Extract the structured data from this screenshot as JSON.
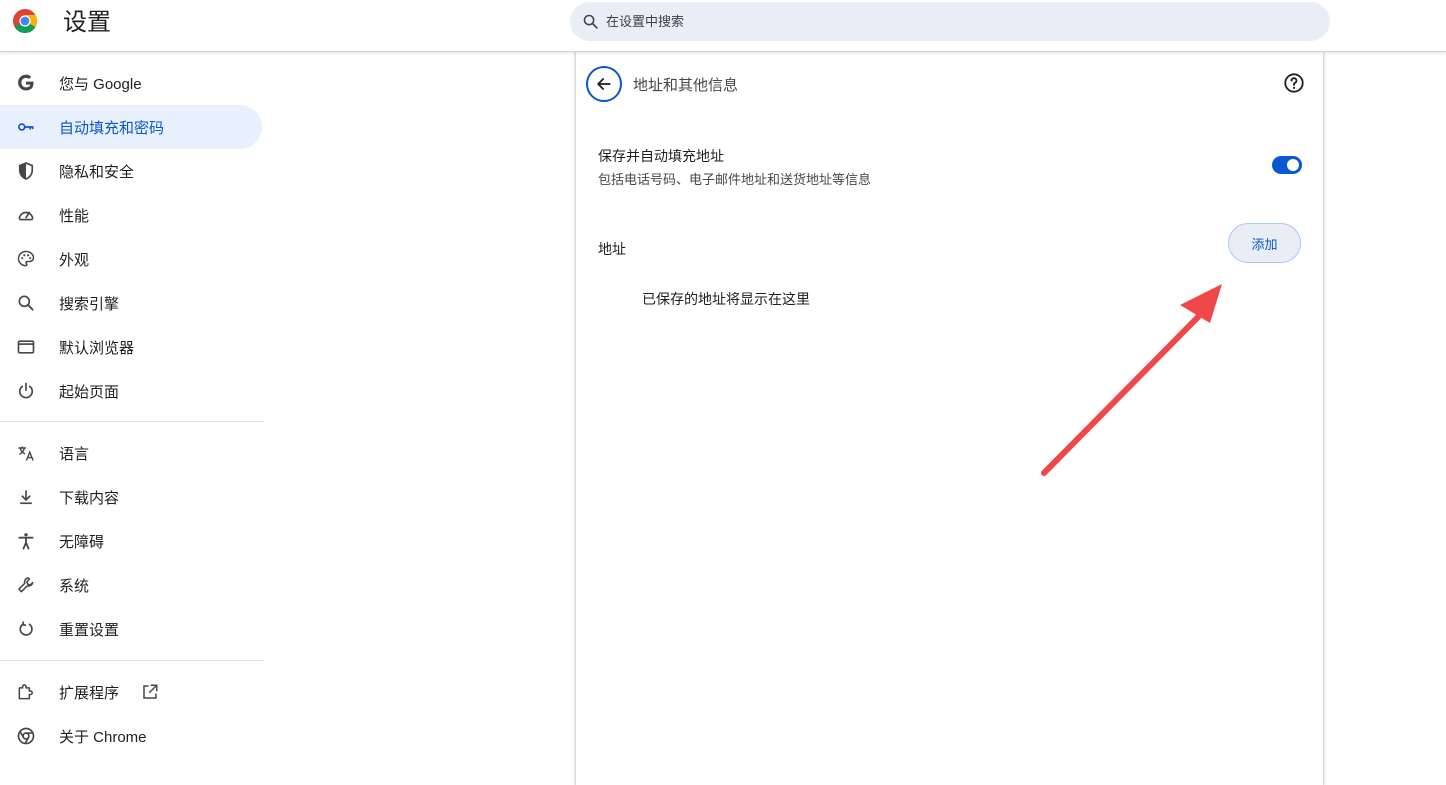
{
  "header": {
    "title": "设置",
    "logo_icon": "chrome-logo-icon",
    "search": {
      "placeholder": "在设置中搜索",
      "value": ""
    }
  },
  "sidebar": {
    "items": [
      {
        "label": "您与 Google",
        "icon": "google-g-icon",
        "active": false
      },
      {
        "label": "自动填充和密码",
        "icon": "key-icon",
        "active": true
      },
      {
        "label": "隐私和安全",
        "icon": "shield-icon",
        "active": false
      },
      {
        "label": "性能",
        "icon": "speedometer-icon",
        "active": false
      },
      {
        "label": "外观",
        "icon": "palette-icon",
        "active": false
      },
      {
        "label": "搜索引擎",
        "icon": "search-icon",
        "active": false
      },
      {
        "label": "默认浏览器",
        "icon": "browser-window-icon",
        "active": false
      },
      {
        "label": "起始页面",
        "icon": "power-icon",
        "active": false
      },
      {
        "label": "语言",
        "icon": "translate-icon",
        "active": false
      },
      {
        "label": "下载内容",
        "icon": "download-icon",
        "active": false
      },
      {
        "label": "无障碍",
        "icon": "accessibility-icon",
        "active": false
      },
      {
        "label": "系统",
        "icon": "wrench-icon",
        "active": false
      },
      {
        "label": "重置设置",
        "icon": "reset-icon",
        "active": false
      },
      {
        "label": "扩展程序",
        "icon": "puzzle-icon",
        "active": false
      },
      {
        "label": "关于 Chrome",
        "icon": "chrome-icon",
        "active": false
      }
    ]
  },
  "main": {
    "page_title": "地址和其他信息",
    "save_setting": {
      "title": "保存并自动填充地址",
      "subtitle": "包括电话号码、电子邮件地址和送货地址等信息",
      "enabled": true
    },
    "addresses_label": "地址",
    "add_button_label": "添加",
    "empty_text": "已保存的地址将显示在这里"
  },
  "colors": {
    "accent": "#0b57d0",
    "active_bg": "#e8effd",
    "search_bg": "#e9eef6",
    "annotation_arrow": "#f04848"
  }
}
